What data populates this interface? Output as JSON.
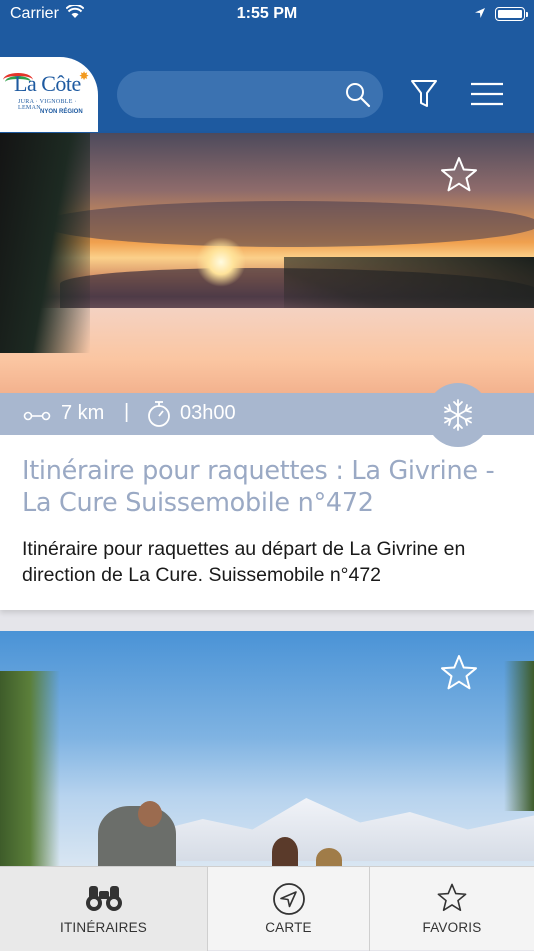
{
  "status_bar": {
    "carrier": "Carrier",
    "time": "1:55 PM"
  },
  "header": {
    "logo": {
      "name": "La Côte",
      "tagline": "JURA · VIGNOBLE · LEMAN",
      "region": "NYON RÉGION"
    },
    "search": {
      "placeholder": "",
      "value": ""
    },
    "icons": [
      "search-icon",
      "filter-icon",
      "menu-icon"
    ]
  },
  "itineraries": [
    {
      "title": "Itinéraire pour raquettes : La Givrine - La Cure Suissemobile n°472",
      "description": "Itinéraire pour raquettes au départ de La Givrine en direction de La Cure. Suissemobile n°472",
      "distance": "7 km",
      "separator": "|",
      "duration": "03h00",
      "activity_icon": "snowflake-icon",
      "favorite": false
    },
    {
      "favorite": false
    }
  ],
  "tabbar": {
    "tabs": [
      {
        "label": "ITINÉRAIRES",
        "icon": "binoculars-icon",
        "active": true
      },
      {
        "label": "CARTE",
        "icon": "navigation-arrow-icon",
        "active": false
      },
      {
        "label": "FAVORIS",
        "icon": "star-icon",
        "active": false
      }
    ]
  },
  "colors": {
    "brand_blue": "#1e5aa0",
    "meta_bar": "#a8b7cf",
    "title_text": "#9aa9c4"
  }
}
